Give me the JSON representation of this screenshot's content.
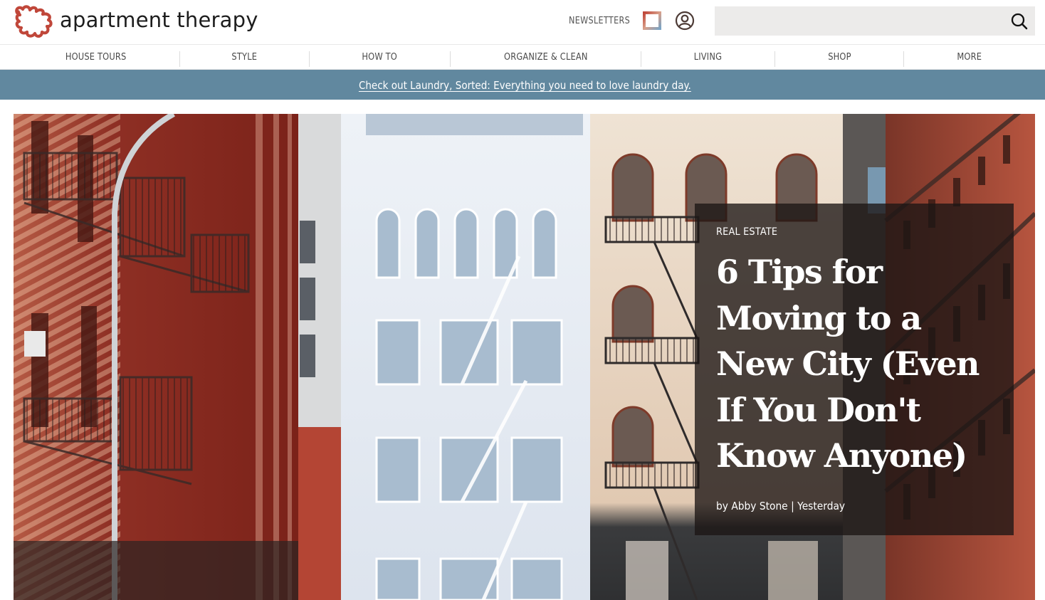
{
  "brand": {
    "name": "apartment therapy",
    "logo_color": "#c0473a"
  },
  "header": {
    "newsletters_label": "NEWSLETTERS",
    "square_icon": "brand-square-icon",
    "account_icon": "account-icon",
    "search": {
      "placeholder": "",
      "value": "",
      "icon": "search-icon"
    }
  },
  "nav": {
    "items": [
      {
        "label": "HOUSE TOURS"
      },
      {
        "label": "STYLE"
      },
      {
        "label": "HOW TO"
      },
      {
        "label": "ORGANIZE & CLEAN"
      },
      {
        "label": "LIVING"
      },
      {
        "label": "SHOP"
      },
      {
        "label": "MORE"
      }
    ]
  },
  "banner": {
    "text": "Check out Laundry, Sorted: Everything you need to love laundry day.",
    "background": "#61889f"
  },
  "hero": {
    "category": "REAL ESTATE",
    "headline": "6 Tips for Moving to a New City (Even If You Don't Know Anyone)",
    "byline": "by Abby Stone | Yesterday",
    "image_description": "New York City cast-iron building facades with fire escapes"
  }
}
